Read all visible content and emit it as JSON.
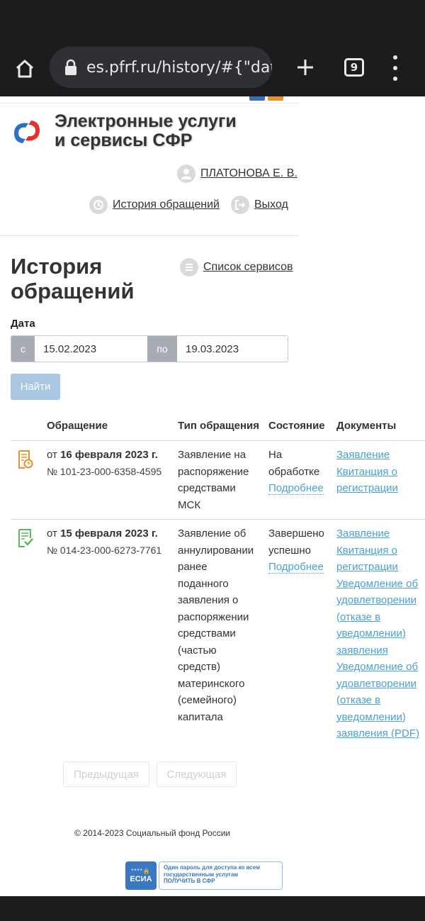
{
  "browser": {
    "url": "es.pfrf.ru/history/#{\"date",
    "tab_count": "9"
  },
  "header": {
    "brand_line1": "Электронные услуги",
    "brand_line2": "и сервисы СФР",
    "user_name": "ПЛАТОНОВА Е. В.",
    "history_link": "История обращений",
    "logout_link": "Выход",
    "colors": {
      "logo_blue": "#2f6fc0",
      "logo_red": "#e2322d"
    }
  },
  "main": {
    "title_line1": "История",
    "title_line2": "обращений",
    "services_link": "Список сервисов",
    "date_label": "Дата",
    "date_from_prefix": "с",
    "date_from": "15.02.2023",
    "date_to_prefix": "по",
    "date_to": "19.03.2023",
    "find_button": "Найти"
  },
  "table": {
    "headers": [
      "Обращение",
      "Тип обращения",
      "Состояние",
      "Документы"
    ],
    "rows": [
      {
        "date_prefix": "от ",
        "date": "16 февраля 2023 г.",
        "number": "№ 101-23-000-6358-4595",
        "type_lines": [
          "Заявление на",
          "распоряжение",
          "средствами",
          "МСК"
        ],
        "status_lines": [
          "На",
          "обработке"
        ],
        "details": "Подробнее",
        "docs": [
          "Заявление",
          "Квитанция о",
          "регистрации"
        ],
        "icon": "document-clock-icon"
      },
      {
        "date_prefix": "от ",
        "date": "15 февраля 2023 г.",
        "number": "№ 014-23-000-6273-7761",
        "type_lines": [
          "Заявление об",
          "аннулировании",
          "ранее",
          "поданного",
          "заявления о",
          "распоряжении",
          "средствами",
          "(частью",
          "средств)",
          "материнского",
          "(семейного)",
          "капитала"
        ],
        "status_lines": [
          "Завершено",
          "успешно"
        ],
        "details": "Подробнее",
        "docs": [
          "Заявление",
          "Квитанция о",
          "регистрации",
          "Уведомление об",
          "удовлетворении",
          "(отказе в",
          "уведомлении)",
          "заявления",
          "Уведомление об",
          "удовлетворении",
          "(отказе в",
          "уведомлении)",
          "заявления (PDF)"
        ],
        "icon": "document-check-icon"
      }
    ]
  },
  "pagination": {
    "prev": "Предыдущая",
    "next": "Следующая"
  },
  "footer": {
    "copyright": "© 2014-2023 Социальный фонд России",
    "esia_stars": "****🔒",
    "esia_word": "ЕСИА",
    "esia_line1": "Один пароль для доступа ко всем",
    "esia_line2": "государственным услугам",
    "esia_line3": "ПОЛУЧИТЬ В СФР"
  }
}
